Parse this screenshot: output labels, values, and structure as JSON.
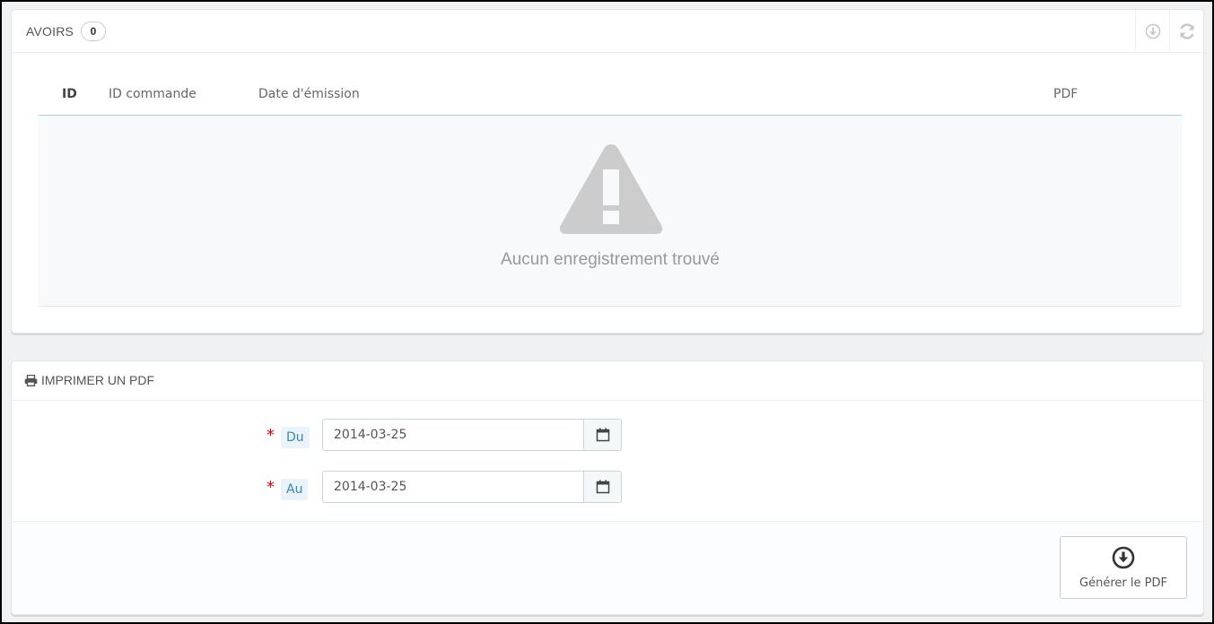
{
  "credits": {
    "title": "AVOIRS",
    "count": "0",
    "columns": {
      "id": "ID",
      "order_id": "ID commande",
      "date": "Date d'émission",
      "pdf": "PDF"
    },
    "empty_message": "Aucun enregistrement trouvé",
    "icons": {
      "export": "download-circle-icon",
      "refresh": "refresh-icon",
      "empty": "warning-triangle-icon"
    }
  },
  "print": {
    "title": "IMPRIMER UN PDF",
    "title_icon": "printer-icon",
    "from": {
      "required_mark": "*",
      "label": "Du",
      "value": "2014-03-25",
      "icon": "calendar-icon"
    },
    "to": {
      "required_mark": "*",
      "label": "Au",
      "value": "2014-03-25",
      "icon": "calendar-icon"
    },
    "generate_button": {
      "label": "Générer le PDF",
      "icon": "download-circle-icon"
    }
  },
  "colors": {
    "required": "#ee0000",
    "label_text": "#3586c1",
    "label_bg": "#eaf3fa",
    "table_header_border": "#a0d0eb"
  }
}
